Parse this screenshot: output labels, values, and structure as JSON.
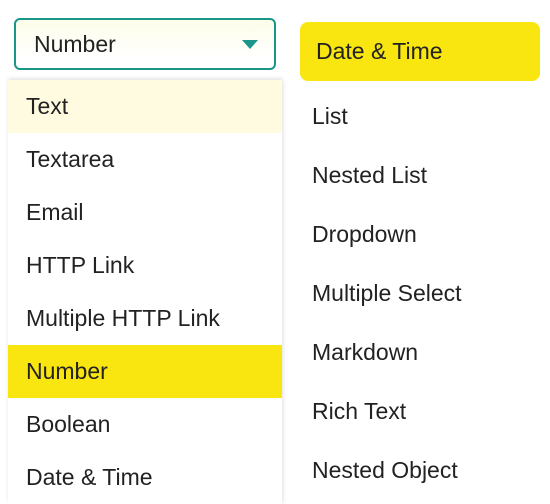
{
  "select": {
    "current": "Number"
  },
  "left_options": {
    "items": [
      {
        "label": "Text",
        "state": "hovered"
      },
      {
        "label": "Textarea",
        "state": ""
      },
      {
        "label": "Email",
        "state": ""
      },
      {
        "label": "HTTP Link",
        "state": ""
      },
      {
        "label": "Multiple HTTP Link",
        "state": ""
      },
      {
        "label": "Number",
        "state": "selected"
      },
      {
        "label": "Boolean",
        "state": ""
      },
      {
        "label": "Date & Time",
        "state": ""
      }
    ]
  },
  "right_options": {
    "items": [
      {
        "label": "Date & Time",
        "state": "selected"
      },
      {
        "label": "List",
        "state": ""
      },
      {
        "label": "Nested List",
        "state": ""
      },
      {
        "label": "Dropdown",
        "state": ""
      },
      {
        "label": "Multiple Select",
        "state": ""
      },
      {
        "label": "Markdown",
        "state": ""
      },
      {
        "label": "Rich Text",
        "state": ""
      },
      {
        "label": "Nested Object",
        "state": ""
      }
    ]
  }
}
